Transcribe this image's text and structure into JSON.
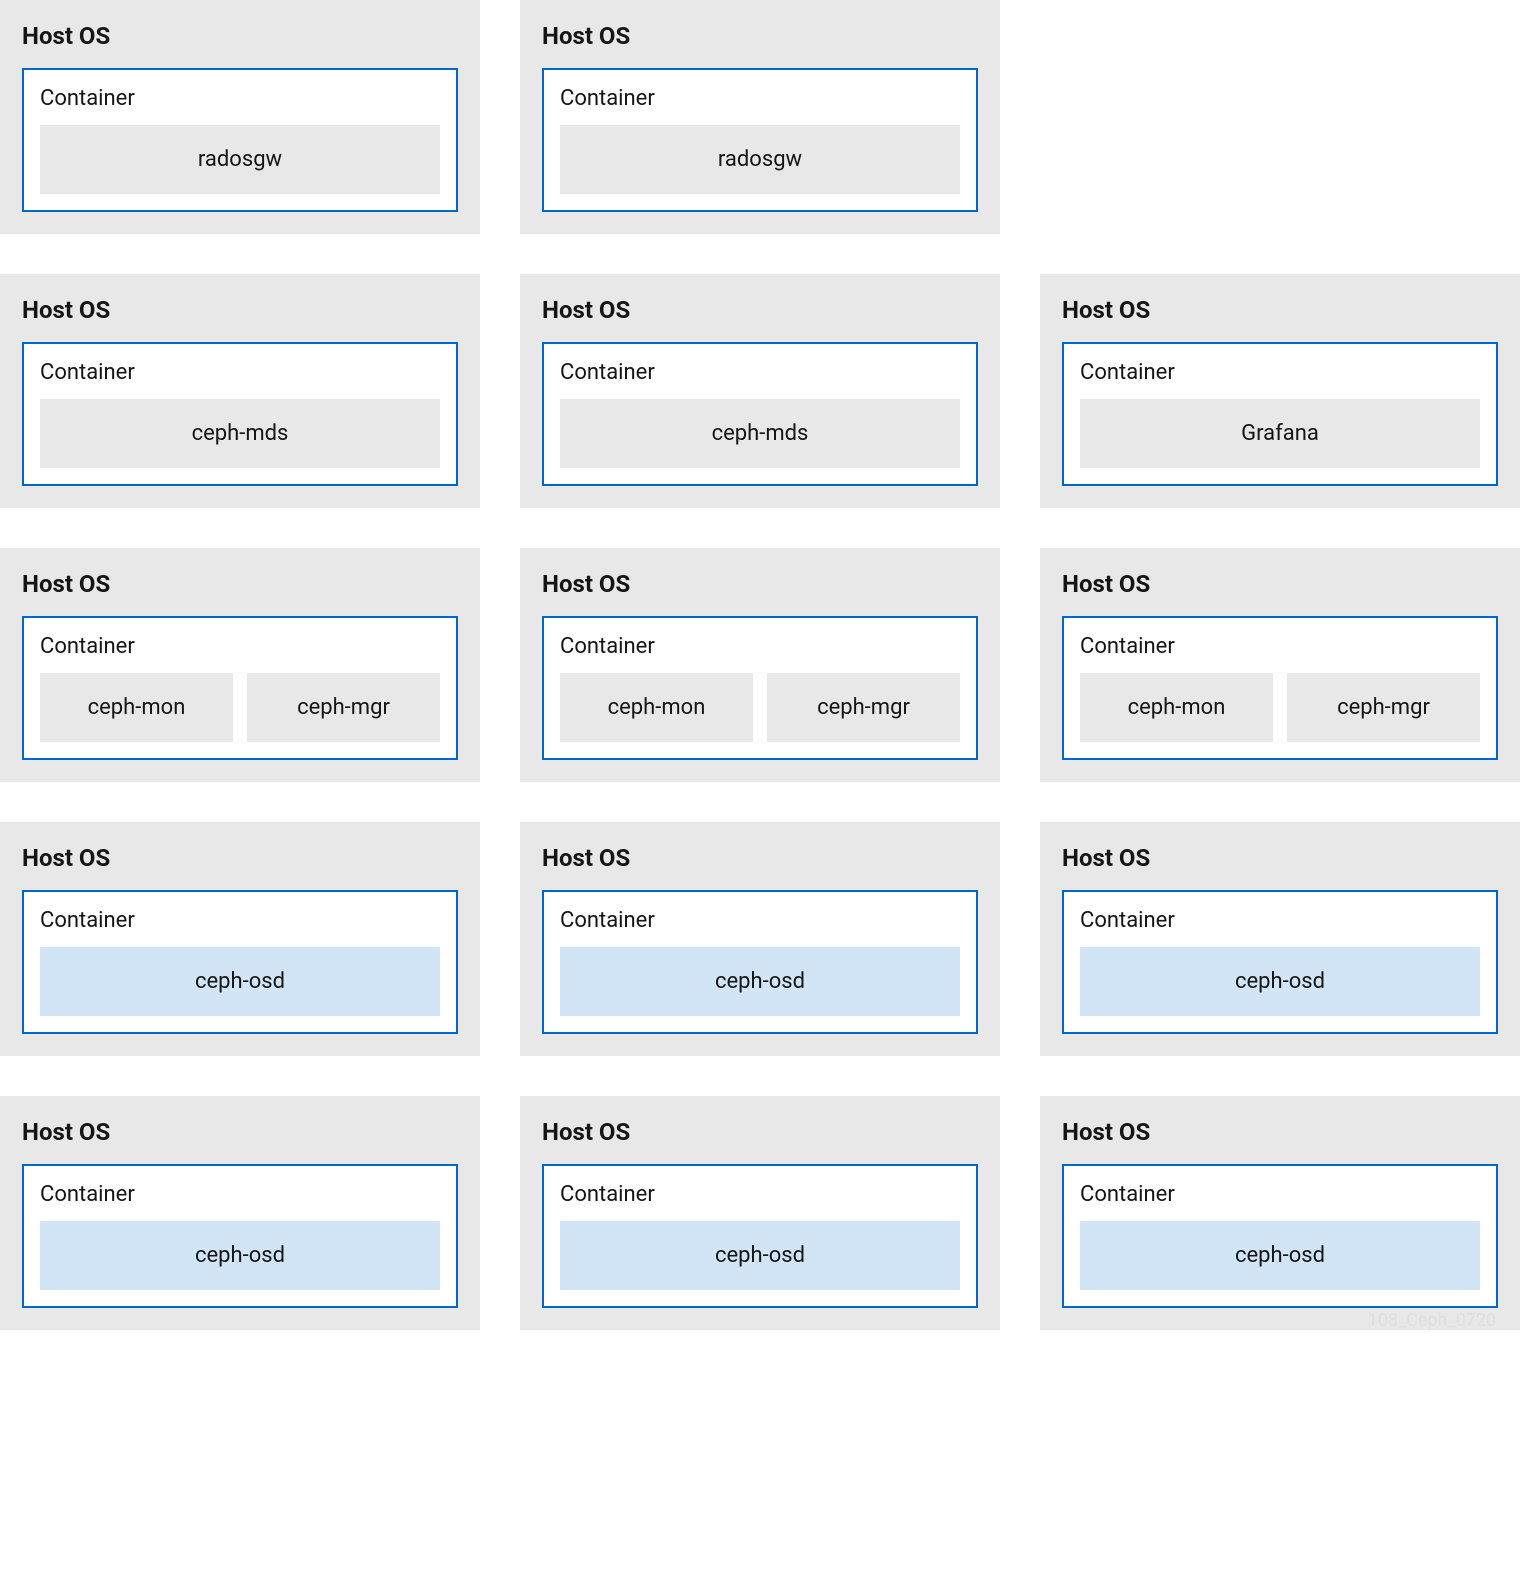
{
  "labels": {
    "host": "Host OS",
    "container": "Container"
  },
  "colors": {
    "host_bg": "#e8e8e8",
    "container_border": "#0066cc",
    "service_gray": "#e8e8e8",
    "service_blue": "#d2e5f7"
  },
  "rows": [
    [
      {
        "services": [
          {
            "name": "radosgw",
            "color": "gray"
          }
        ]
      },
      {
        "services": [
          {
            "name": "radosgw",
            "color": "gray"
          }
        ]
      },
      null
    ],
    [
      {
        "services": [
          {
            "name": "ceph-mds",
            "color": "gray"
          }
        ]
      },
      {
        "services": [
          {
            "name": "ceph-mds",
            "color": "gray"
          }
        ]
      },
      {
        "services": [
          {
            "name": "Grafana",
            "color": "gray"
          }
        ]
      }
    ],
    [
      {
        "services": [
          {
            "name": "ceph-mon",
            "color": "gray"
          },
          {
            "name": "ceph-mgr",
            "color": "gray"
          }
        ]
      },
      {
        "services": [
          {
            "name": "ceph-mon",
            "color": "gray"
          },
          {
            "name": "ceph-mgr",
            "color": "gray"
          }
        ]
      },
      {
        "services": [
          {
            "name": "ceph-mon",
            "color": "gray"
          },
          {
            "name": "ceph-mgr",
            "color": "gray"
          }
        ]
      }
    ],
    [
      {
        "services": [
          {
            "name": "ceph-osd",
            "color": "blue"
          }
        ]
      },
      {
        "services": [
          {
            "name": "ceph-osd",
            "color": "blue"
          }
        ]
      },
      {
        "services": [
          {
            "name": "ceph-osd",
            "color": "blue"
          }
        ]
      }
    ],
    [
      {
        "services": [
          {
            "name": "ceph-osd",
            "color": "blue"
          }
        ]
      },
      {
        "services": [
          {
            "name": "ceph-osd",
            "color": "blue"
          }
        ]
      },
      {
        "services": [
          {
            "name": "ceph-osd",
            "color": "blue"
          }
        ]
      }
    ]
  ],
  "footer": "108_Ceph_0720"
}
